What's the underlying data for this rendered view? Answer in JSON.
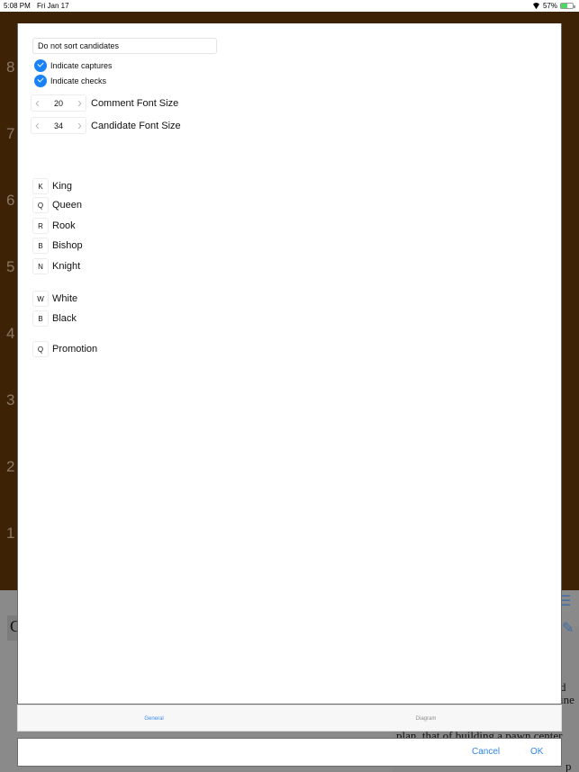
{
  "status_bar": {
    "time": "5:08 PM",
    "date": "Fri Jan 17",
    "battery": "57%",
    "battery_level": 0.57
  },
  "background": {
    "ranks": [
      "8",
      "7",
      "6",
      "5",
      "4",
      "3",
      "2",
      "1"
    ],
    "panel_left_text": "C",
    "text_lines": [
      "d",
      "ine",
      "plan, that of building a pawn center",
      "p"
    ],
    "icons": [
      "menu-icon",
      "edit-icon"
    ]
  },
  "settings": {
    "sort_option": "Do not sort candidates",
    "checkboxes": [
      {
        "label": "Indicate captures",
        "checked": true
      },
      {
        "label": "Indicate checks",
        "checked": true
      }
    ],
    "steppers": [
      {
        "value": "20",
        "label": "Comment Font Size"
      },
      {
        "value": "34",
        "label": "Candidate Font Size"
      }
    ],
    "pieces": [
      {
        "symbol": "K",
        "label": "King"
      },
      {
        "symbol": "Q",
        "label": "Queen"
      },
      {
        "symbol": "R",
        "label": "Rook"
      },
      {
        "symbol": "B",
        "label": "Bishop"
      },
      {
        "symbol": "N",
        "label": "Knight"
      }
    ],
    "colors": [
      {
        "symbol": "W",
        "label": "White"
      },
      {
        "symbol": "B",
        "label": "Black"
      }
    ],
    "promotion": {
      "symbol": "Q",
      "label": "Promotion"
    }
  },
  "tabs": [
    {
      "label": "General",
      "active": true
    },
    {
      "label": "Diagram",
      "active": false
    }
  ],
  "footer": {
    "cancel_label": "Cancel",
    "ok_label": "OK"
  },
  "colors": {
    "accent": "#1a82f7",
    "board_background": "#3d2206"
  }
}
